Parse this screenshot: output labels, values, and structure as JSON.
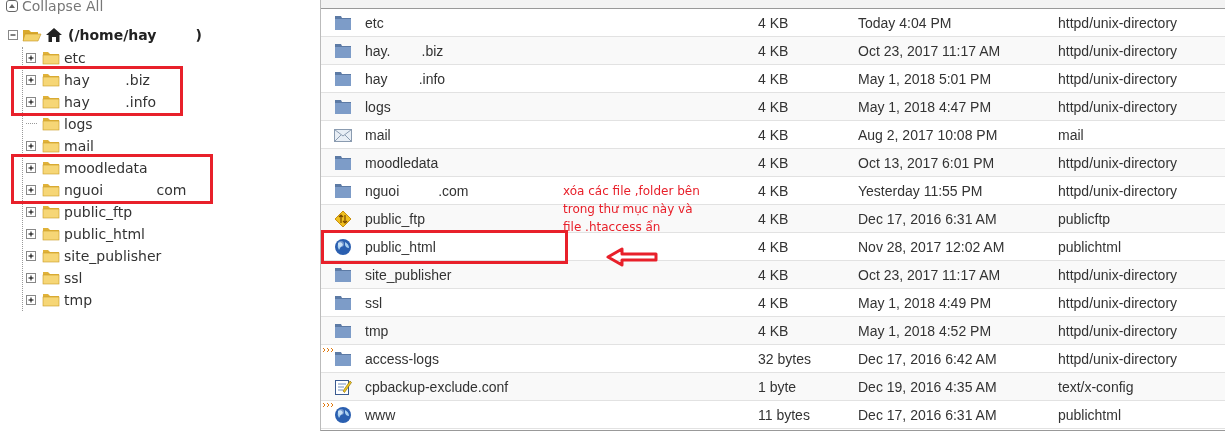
{
  "collapse_all": {
    "label": "Collapse All"
  },
  "tree": {
    "label": "(/home/hay        )",
    "expanded": true,
    "children": [
      {
        "label": "etc",
        "expandable": true,
        "marked": false
      },
      {
        "label": "hay        .biz",
        "expandable": true,
        "marked": true
      },
      {
        "label": "hay        .info",
        "expandable": true,
        "marked": true
      },
      {
        "label": "logs",
        "expandable": false,
        "marked": false
      },
      {
        "label": "mail",
        "expandable": true,
        "marked": false
      },
      {
        "label": "moodledata",
        "expandable": true,
        "marked": true
      },
      {
        "label": "nguoi            com",
        "expandable": true,
        "marked": true
      },
      {
        "label": "public_ftp",
        "expandable": true,
        "marked": false
      },
      {
        "label": "public_html",
        "expandable": true,
        "marked": false
      },
      {
        "label": "site_publisher",
        "expandable": true,
        "marked": false
      },
      {
        "label": "ssl",
        "expandable": true,
        "marked": false
      },
      {
        "label": "tmp",
        "expandable": true,
        "marked": false
      }
    ]
  },
  "files": [
    {
      "kind": "folder",
      "link": false,
      "marked": false,
      "name": "etc",
      "size": "4 KB",
      "modified": "Today 4:04 PM",
      "type": "httpd/unix-directory"
    },
    {
      "kind": "folder",
      "link": false,
      "marked": false,
      "name": "hay.        .biz",
      "size": "4 KB",
      "modified": "Oct 23, 2017 11:17 AM",
      "type": "httpd/unix-directory"
    },
    {
      "kind": "folder",
      "link": false,
      "marked": false,
      "name": "hay        .info",
      "size": "4 KB",
      "modified": "May 1, 2018 5:01 PM",
      "type": "httpd/unix-directory"
    },
    {
      "kind": "folder",
      "link": false,
      "marked": false,
      "name": "logs",
      "size": "4 KB",
      "modified": "May 1, 2018 4:47 PM",
      "type": "httpd/unix-directory"
    },
    {
      "kind": "mail",
      "link": false,
      "marked": false,
      "name": "mail",
      "size": "4 KB",
      "modified": "Aug 2, 2017 10:08 PM",
      "type": "mail"
    },
    {
      "kind": "folder",
      "link": false,
      "marked": false,
      "name": "moodledata",
      "size": "4 KB",
      "modified": "Oct 13, 2017 6:01 PM",
      "type": "httpd/unix-directory"
    },
    {
      "kind": "folder",
      "link": false,
      "marked": false,
      "name": "nguoi          .com",
      "size": "4 KB",
      "modified": "Yesterday 11:55 PM",
      "type": "httpd/unix-directory"
    },
    {
      "kind": "ftp",
      "link": false,
      "marked": false,
      "name": "public_ftp",
      "size": "4 KB",
      "modified": "Dec 17, 2016 6:31 AM",
      "type": "publicftp"
    },
    {
      "kind": "globe",
      "link": false,
      "marked": true,
      "name": "public_html",
      "size": "4 KB",
      "modified": "Nov 28, 2017 12:02 AM",
      "type": "publichtml"
    },
    {
      "kind": "folder",
      "link": false,
      "marked": false,
      "name": "site_publisher",
      "size": "4 KB",
      "modified": "Oct 23, 2017 11:17 AM",
      "type": "httpd/unix-directory"
    },
    {
      "kind": "folder",
      "link": false,
      "marked": false,
      "name": "ssl",
      "size": "4 KB",
      "modified": "May 1, 2018 4:49 PM",
      "type": "httpd/unix-directory"
    },
    {
      "kind": "folder",
      "link": false,
      "marked": false,
      "name": "tmp",
      "size": "4 KB",
      "modified": "May 1, 2018 4:52 PM",
      "type": "httpd/unix-directory"
    },
    {
      "kind": "folder",
      "link": true,
      "marked": false,
      "name": "access-logs",
      "size": "32 bytes",
      "modified": "Dec 17, 2016 6:42 AM",
      "type": "httpd/unix-directory"
    },
    {
      "kind": "config",
      "link": false,
      "marked": false,
      "name": "cpbackup-exclude.conf",
      "size": "1 byte",
      "modified": "Dec 19, 2016 4:35 AM",
      "type": "text/x-config"
    },
    {
      "kind": "globe",
      "link": true,
      "marked": false,
      "name": "www",
      "size": "11 bytes",
      "modified": "Dec 17, 2016 6:31 AM",
      "type": "publichtml"
    }
  ],
  "annotation": {
    "note_lines": [
      "xóa các file ,folder bên",
      "trong thư mục này và",
      "file .htaccess ẩn"
    ]
  }
}
